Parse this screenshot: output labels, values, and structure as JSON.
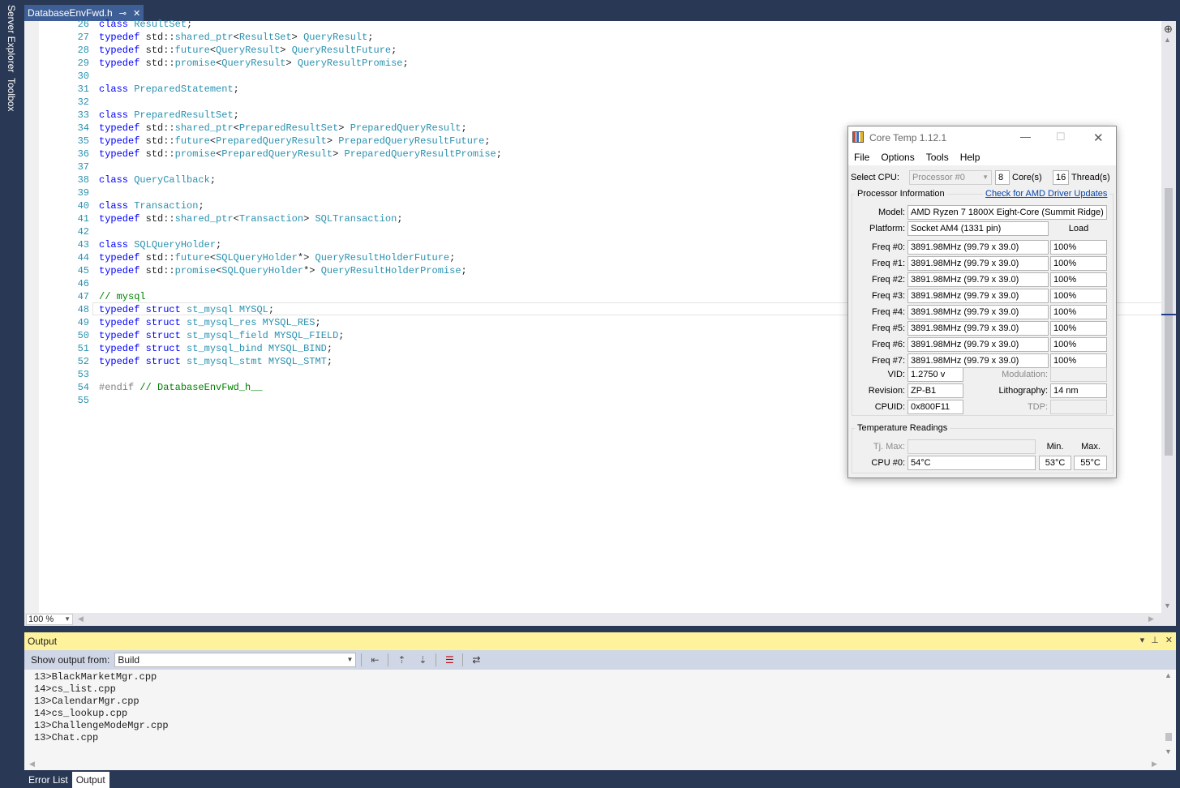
{
  "side_tabs": [
    "Server Explorer",
    "Toolbox"
  ],
  "doc_tab": {
    "title": "DatabaseEnvFwd.h"
  },
  "editor": {
    "zoom": "100 %",
    "lines": [
      {
        "n": "26",
        "html": "<span class='kw'>class</span> <span class='ty'>ResultSet</span>;"
      },
      {
        "n": "27",
        "html": "<span class='kw'>typedef</span> std::<span class='ty'>shared_ptr</span>&lt;<span class='ty'>ResultSet</span>&gt; <span class='ty'>QueryResult</span>;"
      },
      {
        "n": "28",
        "html": "<span class='kw'>typedef</span> std::<span class='ty'>future</span>&lt;<span class='ty'>QueryResult</span>&gt; <span class='ty'>QueryResultFuture</span>;"
      },
      {
        "n": "29",
        "html": "<span class='kw'>typedef</span> std::<span class='ty'>promise</span>&lt;<span class='ty'>QueryResult</span>&gt; <span class='ty'>QueryResultPromise</span>;"
      },
      {
        "n": "30",
        "html": ""
      },
      {
        "n": "31",
        "html": "<span class='kw'>class</span> <span class='ty'>PreparedStatement</span>;"
      },
      {
        "n": "32",
        "html": ""
      },
      {
        "n": "33",
        "html": "<span class='kw'>class</span> <span class='ty'>PreparedResultSet</span>;"
      },
      {
        "n": "34",
        "html": "<span class='kw'>typedef</span> std::<span class='ty'>shared_ptr</span>&lt;<span class='ty'>PreparedResultSet</span>&gt; <span class='ty'>PreparedQueryResult</span>;"
      },
      {
        "n": "35",
        "html": "<span class='kw'>typedef</span> std::<span class='ty'>future</span>&lt;<span class='ty'>PreparedQueryResult</span>&gt; <span class='ty'>PreparedQueryResultFuture</span>;"
      },
      {
        "n": "36",
        "html": "<span class='kw'>typedef</span> std::<span class='ty'>promise</span>&lt;<span class='ty'>PreparedQueryResult</span>&gt; <span class='ty'>PreparedQueryResultPromise</span>;"
      },
      {
        "n": "37",
        "html": ""
      },
      {
        "n": "38",
        "html": "<span class='kw'>class</span> <span class='ty'>QueryCallback</span>;"
      },
      {
        "n": "39",
        "html": ""
      },
      {
        "n": "40",
        "html": "<span class='kw'>class</span> <span class='ty'>Transaction</span>;"
      },
      {
        "n": "41",
        "html": "<span class='kw'>typedef</span> std::<span class='ty'>shared_ptr</span>&lt;<span class='ty'>Transaction</span>&gt; <span class='ty'>SQLTransaction</span>;"
      },
      {
        "n": "42",
        "html": ""
      },
      {
        "n": "43",
        "html": "<span class='kw'>class</span> <span class='ty'>SQLQueryHolder</span>;"
      },
      {
        "n": "44",
        "html": "<span class='kw'>typedef</span> std::<span class='ty'>future</span>&lt;<span class='ty'>SQLQueryHolder</span>*&gt; <span class='ty'>QueryResultHolderFuture</span>;"
      },
      {
        "n": "45",
        "html": "<span class='kw'>typedef</span> std::<span class='ty'>promise</span>&lt;<span class='ty'>SQLQueryHolder</span>*&gt; <span class='ty'>QueryResultHolderPromise</span>;"
      },
      {
        "n": "46",
        "html": ""
      },
      {
        "n": "47",
        "html": "<span class='cm'>// mysql</span>"
      },
      {
        "n": "48",
        "html": "<span class='kw'>typedef</span> <span class='kw'>struct</span> <span class='ty'>st_mysql</span> <span class='ty'>MYSQL</span>;"
      },
      {
        "n": "49",
        "html": "<span class='kw'>typedef</span> <span class='kw'>struct</span> <span class='ty'>st_mysql_res</span> <span class='ty'>MYSQL_RES</span>;"
      },
      {
        "n": "50",
        "html": "<span class='kw'>typedef</span> <span class='kw'>struct</span> <span class='ty'>st_mysql_field</span> <span class='ty'>MYSQL_FIELD</span>;"
      },
      {
        "n": "51",
        "html": "<span class='kw'>typedef</span> <span class='kw'>struct</span> <span class='ty'>st_mysql_bind</span> <span class='ty'>MYSQL_BIND</span>;"
      },
      {
        "n": "52",
        "html": "<span class='kw'>typedef</span> <span class='kw'>struct</span> <span class='ty'>st_mysql_stmt</span> <span class='ty'>MYSQL_STMT</span>;"
      },
      {
        "n": "53",
        "html": ""
      },
      {
        "n": "54",
        "html": "<span class='pp'>#endif</span> <span class='cm'>// DatabaseEnvFwd_h__</span>"
      },
      {
        "n": "55",
        "html": ""
      }
    ]
  },
  "output": {
    "title": "Output",
    "show_label": "Show output from:",
    "source": "Build",
    "lines": [
      "13>BlackMarketMgr.cpp",
      "14>cs_list.cpp",
      "13>CalendarMgr.cpp",
      "14>cs_lookup.cpp",
      "13>ChallengeModeMgr.cpp",
      "13>Chat.cpp"
    ]
  },
  "bottom_tabs": [
    {
      "label": "Error List",
      "active": false
    },
    {
      "label": "Output",
      "active": true
    }
  ],
  "coretemp": {
    "title": "Core Temp 1.12.1",
    "menu": [
      "File",
      "Options",
      "Tools",
      "Help"
    ],
    "select_cpu_label": "Select CPU:",
    "processor": "Processor #0",
    "cores": "8",
    "cores_label": "Core(s)",
    "threads": "16",
    "threads_label": "Thread(s)",
    "proc_info_title": "Processor Information",
    "driver_link": "Check for AMD Driver Updates",
    "model_label": "Model:",
    "model": "AMD Ryzen 7 1800X Eight-Core (Summit Ridge)",
    "platform_label": "Platform:",
    "platform": "Socket AM4 (1331 pin)",
    "load_label": "Load",
    "freqs": [
      {
        "label": "Freq #0:",
        "value": "3891.98MHz (99.79 x 39.0)",
        "load": "100%"
      },
      {
        "label": "Freq #1:",
        "value": "3891.98MHz (99.79 x 39.0)",
        "load": "100%"
      },
      {
        "label": "Freq #2:",
        "value": "3891.98MHz (99.79 x 39.0)",
        "load": "100%"
      },
      {
        "label": "Freq #3:",
        "value": "3891.98MHz (99.79 x 39.0)",
        "load": "100%"
      },
      {
        "label": "Freq #4:",
        "value": "3891.98MHz (99.79 x 39.0)",
        "load": "100%"
      },
      {
        "label": "Freq #5:",
        "value": "3891.98MHz (99.79 x 39.0)",
        "load": "100%"
      },
      {
        "label": "Freq #6:",
        "value": "3891.98MHz (99.79 x 39.0)",
        "load": "100%"
      },
      {
        "label": "Freq #7:",
        "value": "3891.98MHz (99.79 x 39.0)",
        "load": "100%"
      }
    ],
    "vid_label": "VID:",
    "vid": "1.2750 v",
    "modulation_label": "Modulation:",
    "revision_label": "Revision:",
    "revision": "ZP-B1",
    "lithography_label": "Lithography:",
    "lithography": "14 nm",
    "cpuid_label": "CPUID:",
    "cpuid": "0x800F11",
    "tdp_label": "TDP:",
    "temp_title": "Temperature Readings",
    "tjmax_label": "Tj. Max:",
    "min_label": "Min.",
    "max_label": "Max.",
    "cpu0_label": "CPU #0:",
    "cpu0_temp": "54°C",
    "cpu0_min": "53°C",
    "cpu0_max": "55°C"
  },
  "colors": {
    "accent": "#293955",
    "output_header": "#fff29d",
    "keyword": "#0000ff",
    "type": "#2b91af",
    "comment": "#008000"
  }
}
